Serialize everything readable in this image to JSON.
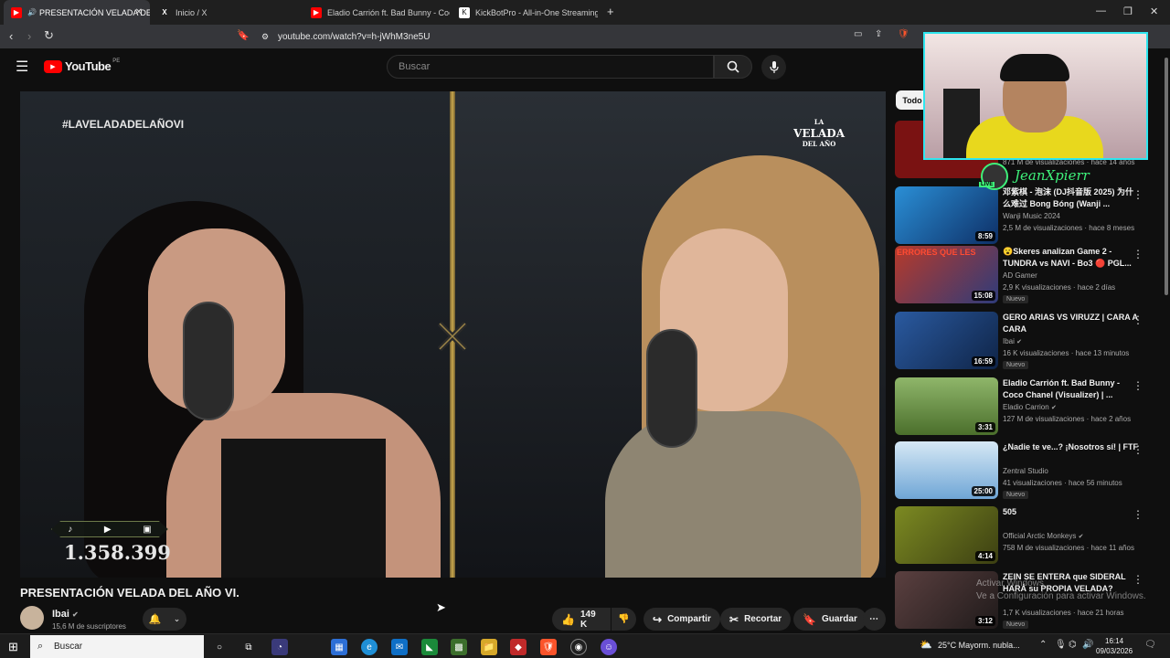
{
  "browser": {
    "tabs": [
      {
        "title": "PRESENTACIÓN VELADA DEL"
      },
      {
        "title": "Inicio / X"
      },
      {
        "title": "Eladio Carrión ft. Bad Bunny - Coco C"
      },
      {
        "title": "KickBotPro - All-in-One Streaming To"
      }
    ],
    "new_tab": "+",
    "url": "youtube.com/watch?v=h-jWhM3ne5U"
  },
  "youtube": {
    "logo": "YouTube",
    "region": "PE",
    "search_placeholder": "Buscar"
  },
  "video": {
    "hashtag": "#LAVELADADELAÑOVI",
    "logo_line1": "LA",
    "logo_line2": "VELADA",
    "logo_line3": "DEL AÑO",
    "counter": "1.358.399",
    "title": "PRESENTACIÓN VELADA DEL AÑO VI.",
    "channel": "Ibai",
    "subscribers": "15,6 M de suscriptores",
    "likes": "149 K",
    "share_label": "Compartir",
    "clip_label": "Recortar",
    "save_label": "Guardar"
  },
  "sidebar": {
    "chip": "Todo",
    "items": [
      {
        "title": "",
        "channel": "",
        "meta": "871 M de visualizaciones · hace 14 años",
        "duration": "",
        "badge": "",
        "color": "#7a1212"
      },
      {
        "title": "邓紫棋 - 泡沫 (DJ抖音版 2025) 为什么难过 Bong Bóng (Wanji ...",
        "channel": "Wanji Music 2024",
        "meta": "2,5 M de visualizaciones · hace 8 meses",
        "duration": "8:59",
        "badge": "",
        "color": "#1f6fa8"
      },
      {
        "title": "😮Skeres analizan Game 2 - TUNDRA vs NAVI - Bo3 🔴 PGL...",
        "channel": "AD Gamer",
        "meta": "2,9 K visualizaciones · hace 2 días",
        "duration": "15:08",
        "badge": "Nuevo",
        "color": "#3a4a8a"
      },
      {
        "title": "GERO ARIAS VS VIRUZZ | CARA A CARA",
        "channel": "Ibai",
        "meta": "16 K visualizaciones · hace 13 minutos",
        "duration": "16:59",
        "badge": "Nuevo",
        "color": "#1c3f73"
      },
      {
        "title": "Eladio Carrión ft. Bad Bunny - Coco Chanel (Visualizer) | ...",
        "channel": "Eladio Carrion",
        "meta": "127 M de visualizaciones · hace 2 años",
        "duration": "3:31",
        "badge": "",
        "color": "#5b7a3a"
      },
      {
        "title": "¿Nadie te ve...? ¡Nosotros sí! | FTF",
        "channel": "Zentral Studio",
        "meta": "41 visualizaciones · hace 56 minutos",
        "duration": "25:00",
        "badge": "Nuevo",
        "color": "#6fa6d6"
      },
      {
        "title": "505",
        "channel": "Official Arctic Monkeys",
        "meta": "758 M de visualizaciones · hace 11 años",
        "duration": "4:14",
        "badge": "",
        "color": "#5f6a1e"
      },
      {
        "title": "ZEIN SE ENTERA que SIDERAL HARÁ su PROPIA VELADA?",
        "channel": "",
        "meta": "1,7 K visualizaciones · hace 21 horas",
        "duration": "3:12",
        "badge": "Nuevo",
        "color": "#3a3030"
      }
    ]
  },
  "streamer": {
    "name": "JeanXpierr",
    "live": "LIVE"
  },
  "watermark": {
    "line1": "Activar Windows",
    "line2": "Ve a Configuración para activar Windows."
  },
  "taskbar": {
    "search": "Buscar",
    "weather": "25°C  Mayorm. nubla...",
    "time": "16:14",
    "date": "09/03/2026"
  }
}
